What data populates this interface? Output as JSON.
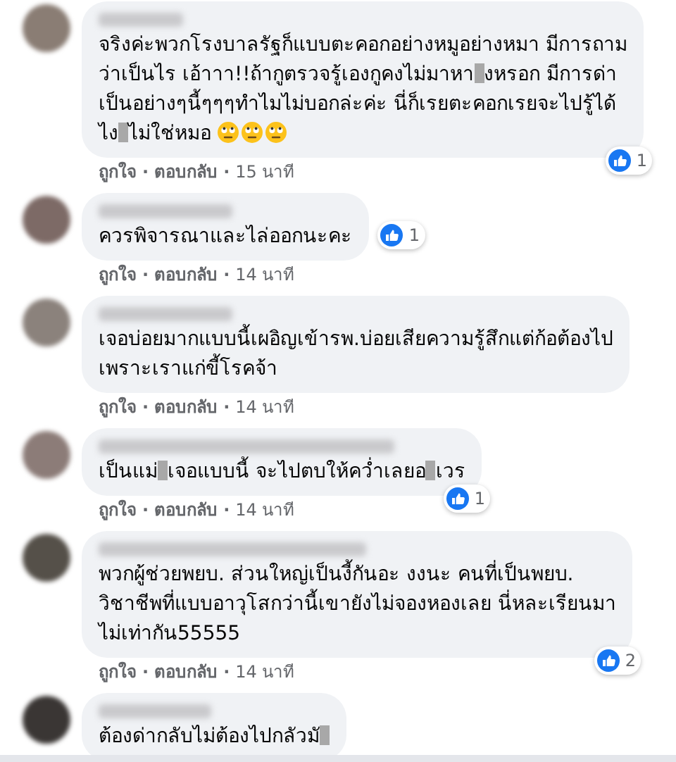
{
  "comments": [
    {
      "lines": [
        [
          {
            "kind": "text",
            "text": "จริงค่ะพวกโรงบาลรัฐก็แบบตะคอกอย่างหมูอย่างหมา มีการถาม"
          }
        ],
        [
          {
            "kind": "text",
            "text": "ว่าเป็นไร เอ้าาา!!ถ้ากูตรวจรู้เองกูคงไม่มาหา"
          },
          {
            "kind": "redaction"
          },
          {
            "kind": "text",
            "text": "งหรอก มีการด่า"
          }
        ],
        [
          {
            "kind": "text",
            "text": "เป็นอย่างๆนี้ๆๆๆทำไมไม่บอกล่ะค่ะ นี่ก็เรยตะคอกเรยจะไปรู้ได้"
          }
        ],
        [
          {
            "kind": "text",
            "text": "ไง"
          },
          {
            "kind": "redaction"
          },
          {
            "kind": "text",
            "text": "ไม่ใช่หมอ "
          },
          {
            "kind": "emoji"
          },
          {
            "kind": "emoji"
          },
          {
            "kind": "emoji"
          }
        ]
      ],
      "reactions": "1",
      "actions": [
        {
          "kind": "link",
          "text": "ถูกใจ"
        },
        {
          "kind": "separator",
          "text": "·"
        },
        {
          "kind": "link",
          "text": "ตอบกลับ"
        },
        {
          "kind": "separator",
          "text": "·"
        },
        {
          "kind": "time",
          "text": "15 นาที"
        }
      ]
    },
    {
      "lines": [
        [
          {
            "kind": "text",
            "text": "ควรพิจารณาและไล่ออกนะคะ"
          }
        ]
      ],
      "reactions": "1",
      "actions": [
        {
          "kind": "link",
          "text": "ถูกใจ"
        },
        {
          "kind": "separator",
          "text": "·"
        },
        {
          "kind": "link",
          "text": "ตอบกลับ"
        },
        {
          "kind": "separator",
          "text": "·"
        },
        {
          "kind": "time",
          "text": "14 นาที"
        }
      ]
    },
    {
      "lines": [
        [
          {
            "kind": "text",
            "text": "เจอบ่อยมากแบบนี้เผอิญเข้ารพ.บ่อยเสียความรู้สึกแต่ก้อต้องไป"
          }
        ],
        [
          {
            "kind": "text",
            "text": "เพราะเราแก่ขี้โรคจ้า"
          }
        ]
      ],
      "actions": [
        {
          "kind": "link",
          "text": "ถูกใจ"
        },
        {
          "kind": "separator",
          "text": "·"
        },
        {
          "kind": "link",
          "text": "ตอบกลับ"
        },
        {
          "kind": "separator",
          "text": "·"
        },
        {
          "kind": "time",
          "text": "14 นาที"
        }
      ]
    },
    {
      "lines": [
        [
          {
            "kind": "text",
            "text": "เป็นแม่"
          },
          {
            "kind": "redaction"
          },
          {
            "kind": "text",
            "text": "เจอแบบนี้ จะไปตบให้คว่ำเลยอ"
          },
          {
            "kind": "redaction"
          },
          {
            "kind": "text",
            "text": "เวร"
          }
        ]
      ],
      "reactions": "1",
      "actions": [
        {
          "kind": "link",
          "text": "ถูกใจ"
        },
        {
          "kind": "separator",
          "text": "·"
        },
        {
          "kind": "link",
          "text": "ตอบกลับ"
        },
        {
          "kind": "separator",
          "text": "·"
        },
        {
          "kind": "time",
          "text": "14 นาที"
        }
      ]
    },
    {
      "lines": [
        [
          {
            "kind": "text",
            "text": "พวกผู้ช่วยพยบ. ส่วนใหญ่เป็นงี้กันอะ งงนะ คนที่เป็นพยบ."
          }
        ],
        [
          {
            "kind": "text",
            "text": "วิชาชีพที่แบบอาวุโสกว่านี้เขายังไม่จองหองเลย นี่หละเรียนมา"
          }
        ],
        [
          {
            "kind": "text",
            "text": "ไม่เท่ากัน55555"
          }
        ]
      ],
      "reactions": "2",
      "actions": [
        {
          "kind": "link",
          "text": "ถูกใจ"
        },
        {
          "kind": "separator",
          "text": "·"
        },
        {
          "kind": "link",
          "text": "ตอบกลับ"
        },
        {
          "kind": "separator",
          "text": "·"
        },
        {
          "kind": "time",
          "text": "14 นาที"
        }
      ]
    },
    {
      "lines": [
        [
          {
            "kind": "text",
            "text": "ต้องด่ากลับไม่ต้องไปกลัวมั"
          },
          {
            "kind": "redaction"
          }
        ]
      ]
    }
  ]
}
